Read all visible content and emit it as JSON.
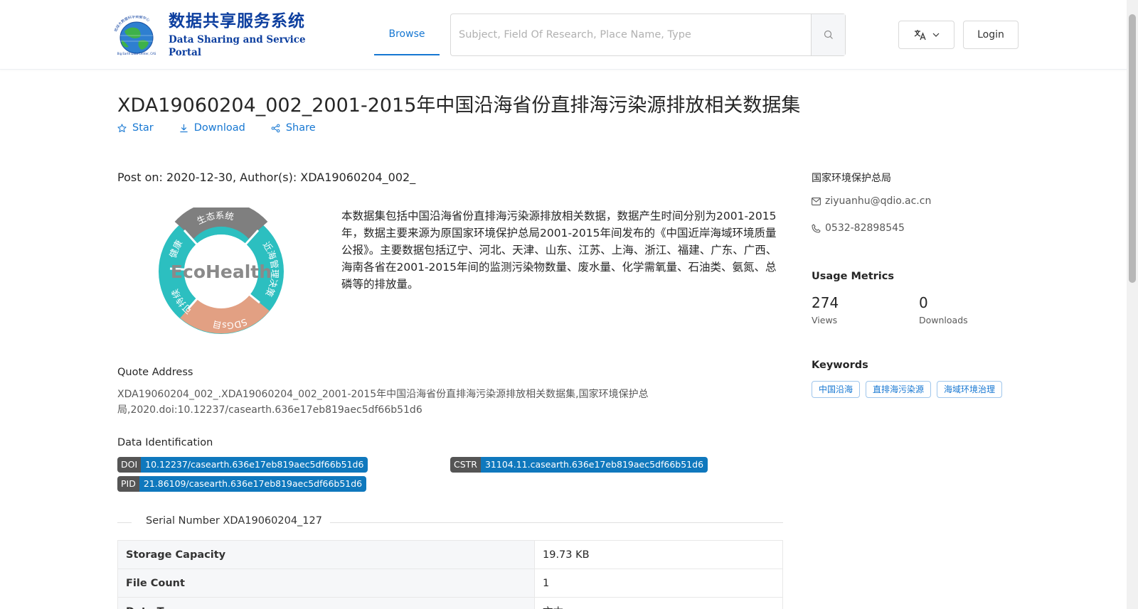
{
  "header": {
    "logo_title_zh": "数据共享服务系统",
    "logo_title_en": "Data Sharing and Service Portal",
    "logo_ring_zh": "地球大数据科学数据中心",
    "logo_ring_en": "Big Earth Data Center, CAS",
    "nav_browse": "Browse",
    "search_placeholder": "Subject, Field Of Research, Place Name, Type",
    "login": "Login"
  },
  "dataset": {
    "title": "XDA19060204_002_2001-2015年中国沿海省份直排海污染源排放相关数据集",
    "actions": {
      "star": "Star",
      "download": "Download",
      "share": "Share"
    },
    "post_on": "Post on: 2020-12-30, Author(s): XDA19060204_002_",
    "cover": {
      "center": "EcoHealth",
      "segments": [
        "生态系统",
        "近海管理决策",
        "SDGs目标",
        "可持续",
        "健康"
      ]
    },
    "description": "本数据集包括中国沿海省份直排海污染源排放相关数据，数据产生时间分别为2001-2015年，数据主要来源为原国家环境保护总局2001-2015年间发布的《中国近岸海域环境质量公报》。主要数据包括辽宁、河北、天津、山东、江苏、上海、浙江、福建、广东、广西、海南各省在2001-2015年间的监测污染物数量、废水量、化学需氧量、石油类、氨氮、总磷等的排放量。",
    "quote_label": "Quote Address",
    "quote_text": "XDA19060204_002_.XDA19060204_002_2001-2015年中国沿海省份直排海污染源排放相关数据集,国家环境保护总局,2020.doi:10.12237/casearth.636e17eb819aec5df66b51d6",
    "identification_label": "Data Identification",
    "identifiers": {
      "doi_k": "DOI",
      "doi_v": "10.12237/casearth.636e17eb819aec5df66b51d6",
      "cstr_k": "CSTR",
      "cstr_v": "31104.11.casearth.636e17eb819aec5df66b51d6",
      "pid_k": "PID",
      "pid_v": "21.86109/casearth.636e17eb819aec5df66b51d6"
    },
    "serial_number": "Serial Number XDA19060204_127",
    "table": [
      {
        "key": "Storage Capacity",
        "value": "19.73 KB"
      },
      {
        "key": "File Count",
        "value": "1"
      },
      {
        "key": "Data Type",
        "value": "文本"
      }
    ]
  },
  "sidebar": {
    "organization": "国家环境保护总局",
    "email": "ziyuanhu@qdio.ac.cn",
    "phone": "0532-82898545",
    "metrics_title": "Usage Metrics",
    "views_count": "274",
    "views_label": "Views",
    "downloads_count": "0",
    "downloads_label": "Downloads",
    "keywords_title": "Keywords",
    "keywords": [
      "中国沿海",
      "直排海污染源",
      "海域环境治理"
    ]
  },
  "colors": {
    "accent": "#1677d2",
    "badge_value": "#0f78bd",
    "badge_key": "#555555",
    "eco_teal": "#2cbfc0",
    "eco_gray": "#7f7f7f",
    "eco_orange": "#e2a083"
  },
  "icons": {
    "search": "search-icon",
    "translate": "translate-icon",
    "star": "star-icon",
    "download": "download-icon",
    "share": "share-icon",
    "mail": "mail-icon",
    "phone": "phone-icon"
  }
}
